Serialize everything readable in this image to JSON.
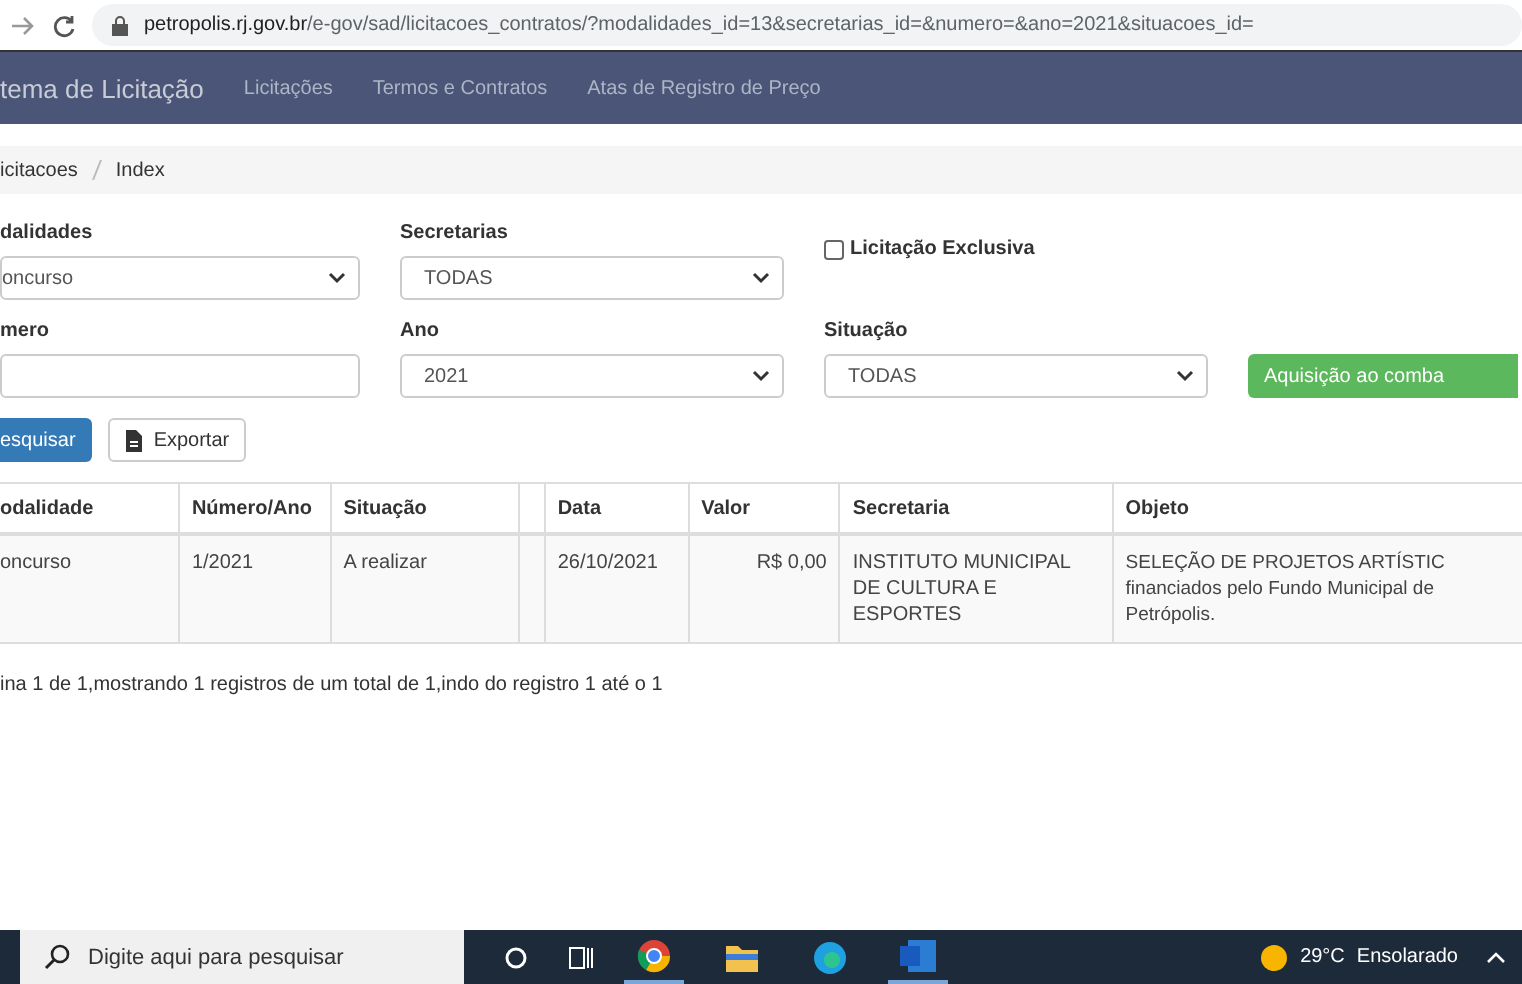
{
  "browser": {
    "url_host": "petropolis.rj.gov.br",
    "url_path": "/e-gov/sad/licitacoes_contratos/?modalidades_id=13&secretarias_id=&numero=&ano=2021&situacoes_id="
  },
  "navbar": {
    "brand": "tema de Licitação",
    "links": [
      "Licitações",
      "Termos e Contratos",
      "Atas de Registro de Preço"
    ]
  },
  "breadcrumb": [
    "icitacoes",
    "Index"
  ],
  "filters": [
    {
      "kind": "select",
      "label": "dalidades",
      "value": "oncurso"
    },
    {
      "kind": "select",
      "label": "Secretarias",
      "value": "TODAS"
    },
    {
      "kind": "checkbox",
      "label": "Licitação Exclusiva",
      "checked": false
    },
    {
      "kind": "input",
      "label": "mero"
    },
    {
      "kind": "select",
      "label": "Ano",
      "value": "2021"
    },
    {
      "kind": "select",
      "label": "Situação",
      "value": "TODAS"
    },
    {
      "kind": "button",
      "label": "Aquisição ao comba"
    }
  ],
  "actions": [
    "esquisar",
    "Exportar"
  ],
  "table": {
    "columns": [
      "odalidade",
      "Número/Ano",
      "Situação",
      null,
      "Data",
      "Valor",
      "Secretaria",
      "Objeto"
    ],
    "rows": [
      [
        "oncurso",
        "1/2021",
        "A realizar",
        null,
        "26/10/2021",
        "R$ 0,00",
        "INSTITUTO MUNICIPAL DE CULTURA E ESPORTES",
        [
          "SELEÇÃO DE PROJETOS ARTÍSTIC",
          "financiados pelo Fundo Municipal de",
          "Petrópolis."
        ]
      ]
    ]
  },
  "pagination": "ina 1 de 1,mostrando 1 registros de um total de 1,indo do registro 1 até o 1",
  "taskbar": {
    "search_placeholder": "Digite aqui para pesquisar",
    "weather": "29°C",
    "weather_text": "Ensolarado"
  }
}
